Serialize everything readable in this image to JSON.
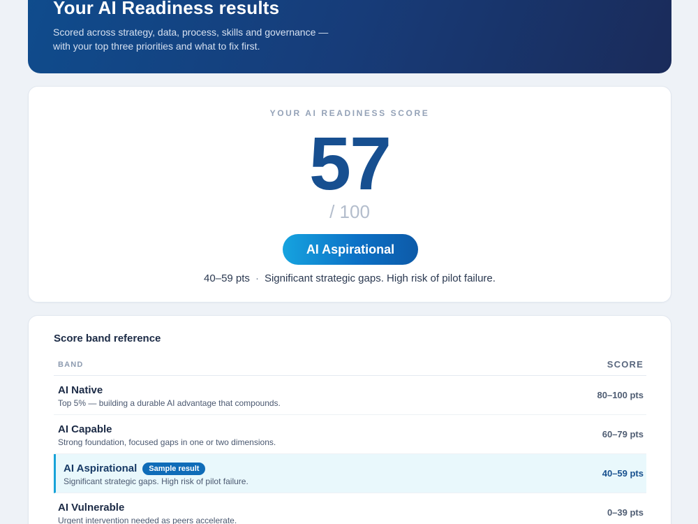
{
  "hero": {
    "title": "Your AI Readiness results",
    "subtitle": "Scored across strategy, data, process, skills and governance — with your top three priorities and what to fix first."
  },
  "score": {
    "eyebrow": "YOUR AI READINESS SCORE",
    "value": "57",
    "max": "/ 100",
    "band_label": "AI Aspirational",
    "band_range": "40–59 pts",
    "separator": "·",
    "band_description": "Significant strategic gaps. High risk of pilot failure."
  },
  "reference": {
    "title": "Score band reference",
    "columns": {
      "band": "BAND",
      "score": "SCORE"
    },
    "rows": [
      {
        "name": "AI Native",
        "description": "Top 5% — building a durable AI advantage that compounds.",
        "points": "80–100 pts"
      },
      {
        "name": "AI Capable",
        "description": "Strong foundation, focused gaps in one or two dimensions.",
        "points": "60–79 pts"
      },
      {
        "name": "AI Aspirational",
        "badge": "Sample result",
        "description": "Significant strategic gaps. High risk of pilot failure.",
        "points": "40–59 pts"
      },
      {
        "name": "AI Vulnerable",
        "description": "Urgent intervention needed as peers accelerate.",
        "points": "0–39 pts"
      }
    ]
  },
  "colors": {
    "brand_blue": "#174f90",
    "accent_cyan": "#17a3d8",
    "hero_gradient_start": "#0f4c8d",
    "hero_gradient_end": "#1a2b5a",
    "active_row_bg": "#e9f8fc"
  }
}
